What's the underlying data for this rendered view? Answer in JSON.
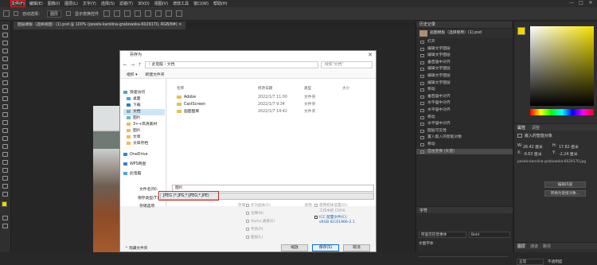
{
  "menubar": {
    "items": [
      "文件(F)",
      "编辑(E)",
      "图像(I)",
      "图层(L)",
      "文字(Y)",
      "选择(S)",
      "滤镜(T)",
      "3D(D)",
      "视图(V)",
      "增效工具",
      "窗口(W)",
      "帮助(H)"
    ],
    "window_controls": [
      "—",
      "□",
      "✕"
    ]
  },
  "options_bar": {
    "auto_select": "自动选择：",
    "auto_select_value": "图层",
    "show_transform": "显示变换控件"
  },
  "document_tab": {
    "label": "图层模板（选择视图）(1).psd @ 100% (pexels-karolina-grabowska-6029170, RGB/8#) ✕"
  },
  "history_panel": {
    "title": "历史记录",
    "snapshot": "画图模板（选择使用）(1).psd",
    "items": [
      "打开",
      "编辑文字图层",
      "编辑文字图层",
      "垂直居中对齐",
      "编辑文字图层",
      "编辑文字图层",
      "编辑文字图层",
      "移动",
      "垂直居中对齐",
      "水平居中对齐",
      "水平居中对齐",
      "移动",
      "水平居中对齐",
      "图层可见性",
      "置入嵌入的智能对象",
      "移动",
      "自由变换 (矢量)"
    ],
    "selected_index": 16
  },
  "char_panel": {
    "title": "字符",
    "font": "阿里巴巴普惠体",
    "style": "Bold",
    "size_label": "文图字体"
  },
  "properties_panel": {
    "tabs": [
      "属性",
      "调整"
    ],
    "header": "嵌入的智能对象",
    "w_label": "W:",
    "w_value": "26.42 厘米",
    "h_label": "H:",
    "h_value": "17.82 厘米",
    "x_label": "X:",
    "x_value": "-9.63 厘米",
    "y_label": "Y:",
    "y_value": "-2.24 厘米",
    "filename": "pexels-karolina-grabowska-6029170.jpg",
    "btn_edit": "编辑内容",
    "btn_convert": "转换为链接对象..."
  },
  "layers_panel": {
    "tabs": [
      "图层",
      "通道",
      "路径"
    ],
    "mode": "正常",
    "opacity_label": "不透明度"
  },
  "dialog": {
    "title": "另存为",
    "path": "› 此电脑 › 文档",
    "search_placeholder": "搜索\"文档\"",
    "organize": "组织 ▾",
    "new_folder": "新建文件夹",
    "nav": [
      "快速访问",
      "桌面",
      "下载",
      "文档",
      "图片",
      "3++高清素材",
      "图片",
      "文章",
      "文章存档",
      "OneDrive",
      "WPS网盘",
      "此电脑"
    ],
    "columns": [
      "名称",
      "修改日期",
      "类型",
      "大小"
    ],
    "files": [
      {
        "name": "Adobe",
        "date": "2022/1/7 11:00",
        "type": "文件夹"
      },
      {
        "name": "CastScreen",
        "date": "2022/1/7 9:34",
        "type": "文件夹"
      },
      {
        "name": "画图图库",
        "date": "2022/1/7 14:42",
        "type": "文件夹"
      }
    ],
    "filename_label": "文件名(N):",
    "filename_value": "图片",
    "filetype_label": "保存类型(T):",
    "filetype_value": "JPEG (*.JPG;*.JPEG;*.JPE)",
    "save_options": "存储选项",
    "storage": "存储：",
    "opt_copy": "作为副本(Y)",
    "opt_notes": "注释(N)",
    "opt_alpha": "Alpha 通道(E)",
    "opt_spot": "专色(P)",
    "opt_layers": "图层(L)",
    "color": "颜色：",
    "opt_proof": "使用校样设置(O):",
    "opt_proof2": "工作中的 CMYK",
    "opt_icc": "ICC 配置文件(C):",
    "opt_icc2": "sRGB IEC61966-2.1",
    "hide_folders": "隐藏文件夹",
    "btn_save": "保存(S)",
    "btn_cancel": "取消",
    "btn_other": "缩放"
  }
}
